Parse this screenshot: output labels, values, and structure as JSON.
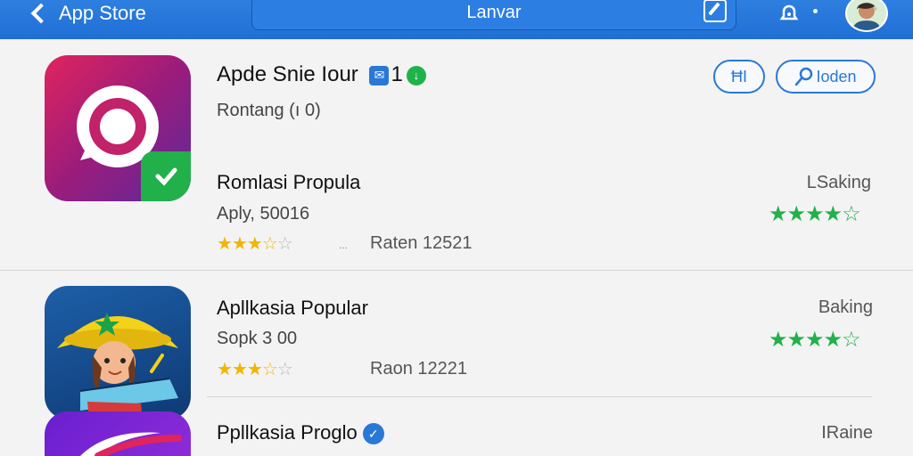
{
  "header": {
    "back_label": "App Store",
    "search_text": "Lanvar"
  },
  "featured": {
    "title": "Apde Snie Iour",
    "count": "1",
    "subtitle": "Rontang  (ı 0)",
    "buttons": {
      "small": "ĦI",
      "open": "Ioden"
    }
  },
  "apps": [
    {
      "title": "Romlasi Propula",
      "sub": "Aply, 50016",
      "rating_text": "Raten  12521",
      "right_label": "LSaking",
      "gold_rating": 3.5,
      "green_rating": 4.5
    },
    {
      "title": "Apllkasia Popular",
      "sub": "Sopk  3 00",
      "rating_text": "Raon  12221",
      "right_label": "Baking",
      "gold_rating": 3.5,
      "green_rating": 4.5
    },
    {
      "title": "Ppllkasia Proglo",
      "right_label": "IRaine"
    }
  ],
  "colors": {
    "header_blue": "#2a78d6",
    "gold_star": "#f2b500",
    "green_star": "#21b14a"
  }
}
